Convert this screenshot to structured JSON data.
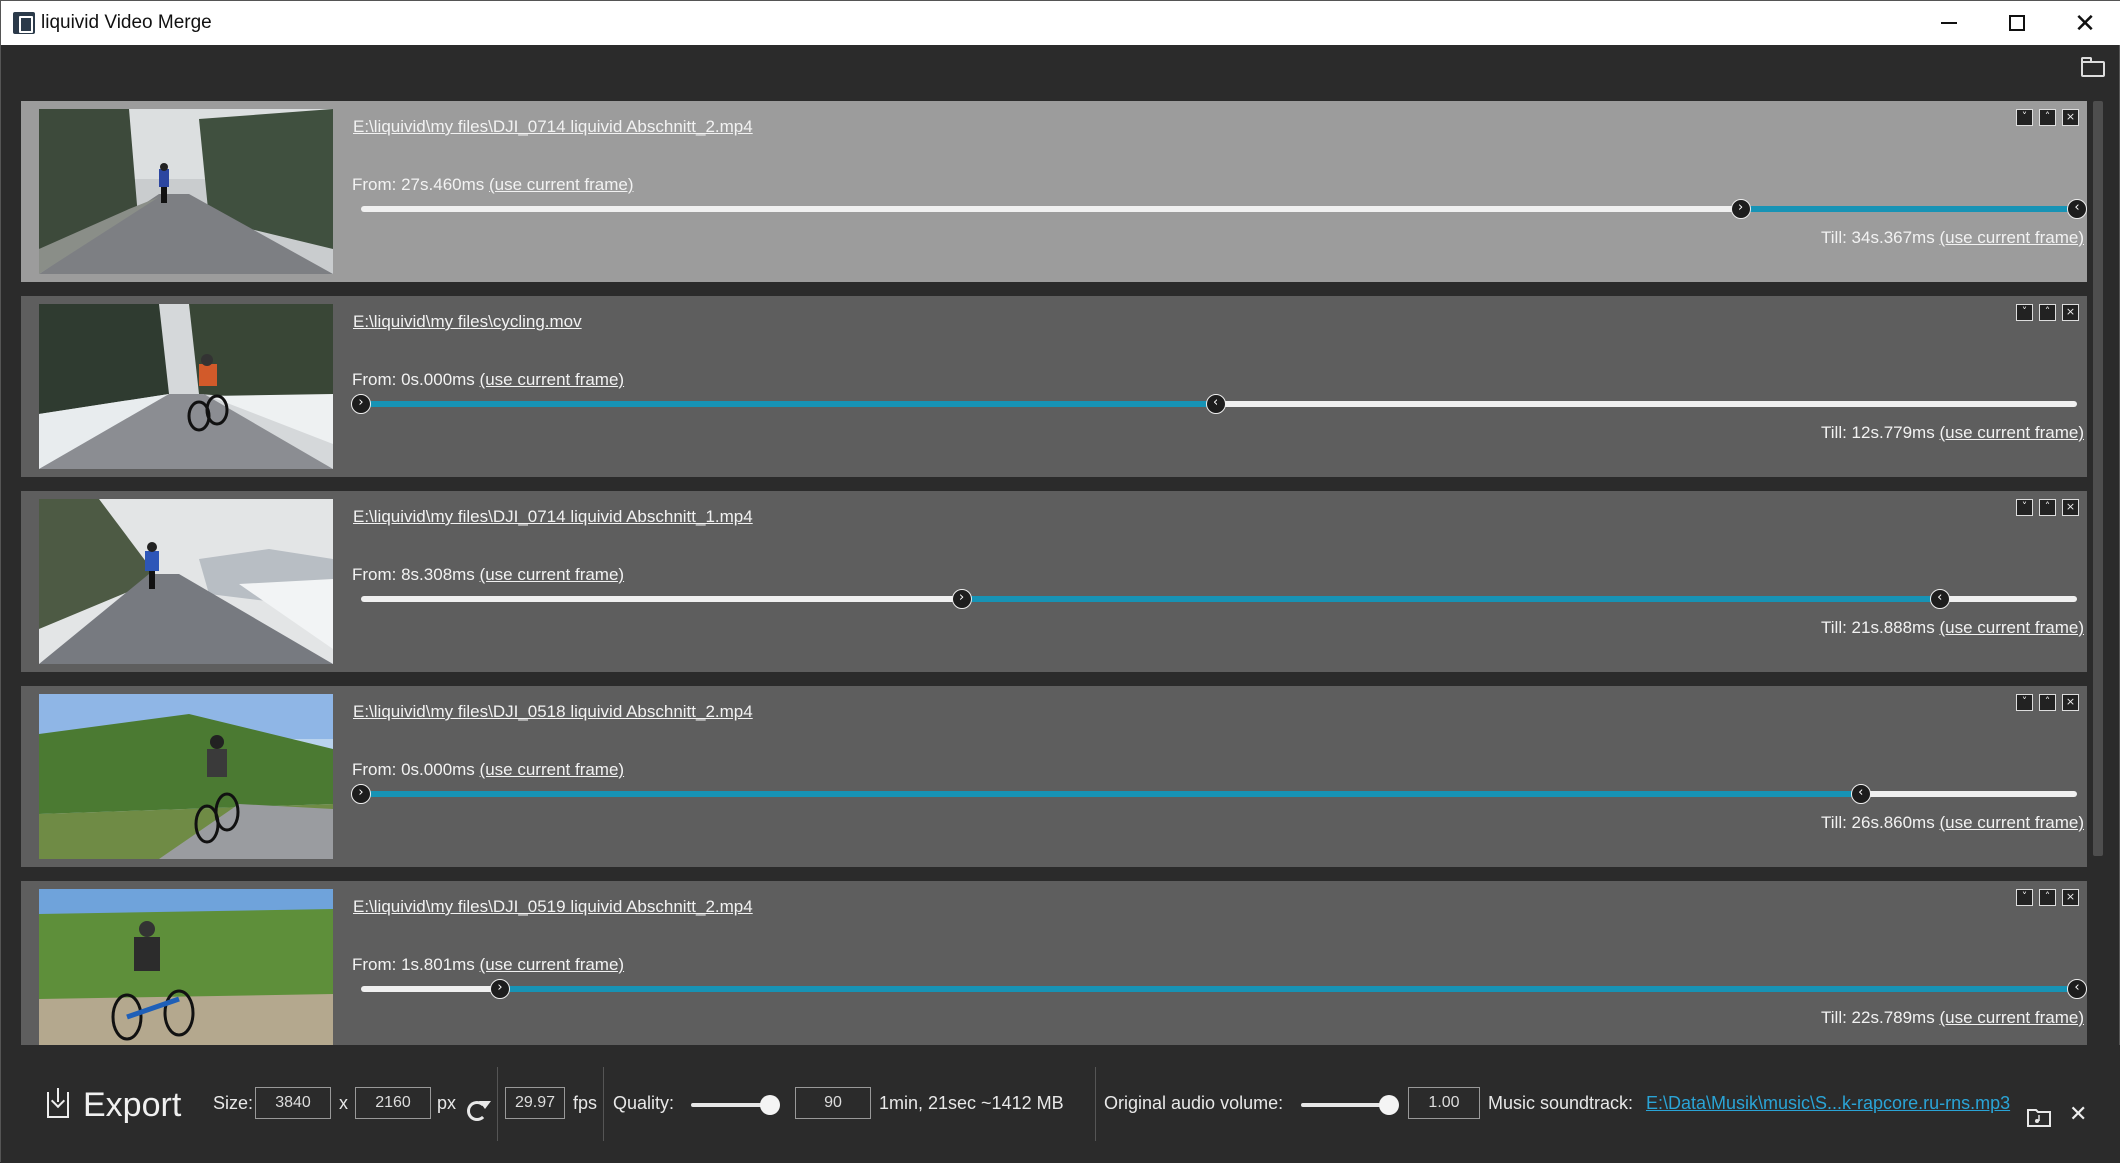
{
  "app": {
    "title": "liquivid Video Merge",
    "icon": "liquivid-app-icon",
    "controls": {
      "minimize": "minimize-icon",
      "maximize": "maximize-icon",
      "close": "close-icon"
    }
  },
  "toolbar": {
    "open_folder_icon": "folder-icon"
  },
  "clips": [
    {
      "path": "E:\\liquivid\\my files\\DJI_0714 liquivid Abschnitt_2.mp4",
      "from_label": "From: 27s.460ms",
      "till_label": "Till: 34s.367ms",
      "use_current_frame": "(use current frame)",
      "range_start_fraction": 0.804,
      "range_end_fraction": 1.0,
      "selected": true
    },
    {
      "path": "E:\\liquivid\\my files\\cycling.mov",
      "from_label": "From: 0s.000ms",
      "till_label": "Till: 12s.779ms",
      "use_current_frame": "(use current frame)",
      "range_start_fraction": 0.0,
      "range_end_fraction": 0.498,
      "selected": false
    },
    {
      "path": "E:\\liquivid\\my files\\DJI_0714 liquivid Abschnitt_1.mp4",
      "from_label": "From: 8s.308ms",
      "till_label": "Till: 21s.888ms",
      "use_current_frame": "(use current frame)",
      "range_start_fraction": 0.35,
      "range_end_fraction": 0.92,
      "selected": false
    },
    {
      "path": "E:\\liquivid\\my files\\DJI_0518 liquivid Abschnitt_2.mp4",
      "from_label": "From: 0s.000ms",
      "till_label": "Till: 26s.860ms",
      "use_current_frame": "(use current frame)",
      "range_start_fraction": 0.0,
      "range_end_fraction": 0.874,
      "selected": false
    },
    {
      "path": "E:\\liquivid\\my files\\DJI_0519 liquivid Abschnitt_2.mp4",
      "from_label": "From: 1s.801ms",
      "till_label": "Till: 22s.789ms",
      "use_current_frame": "(use current frame)",
      "range_start_fraction": 0.081,
      "range_end_fraction": 1.0,
      "selected": false
    }
  ],
  "clip_controls": {
    "move_down": "˅",
    "move_up": "˄",
    "remove": "×"
  },
  "colors": {
    "accent": "#1793b5",
    "selected_clip_bg": "#9c9c9c",
    "clip_bg": "#5e5e5e",
    "window_bg": "#2b2b2b",
    "link": "#2aa4d6"
  },
  "export": {
    "button_label": "Export",
    "size_label": "Size:",
    "width": "3840",
    "x_label": "x",
    "height": "2160",
    "px_label": "px",
    "fps_value": "29.97",
    "fps_label": "fps",
    "quality_label": "Quality:",
    "quality_value": "90",
    "quality_fraction": 0.9,
    "estimate": "1min, 21sec ~1412 MB",
    "audio_label": "Original audio volume:",
    "audio_value": "1.00",
    "audio_fraction": 1.0,
    "music_label": "Music soundtrack:",
    "music_file": "E:\\Data\\Musik\\music\\S...k-rapcore.ru-rns.mp3"
  }
}
